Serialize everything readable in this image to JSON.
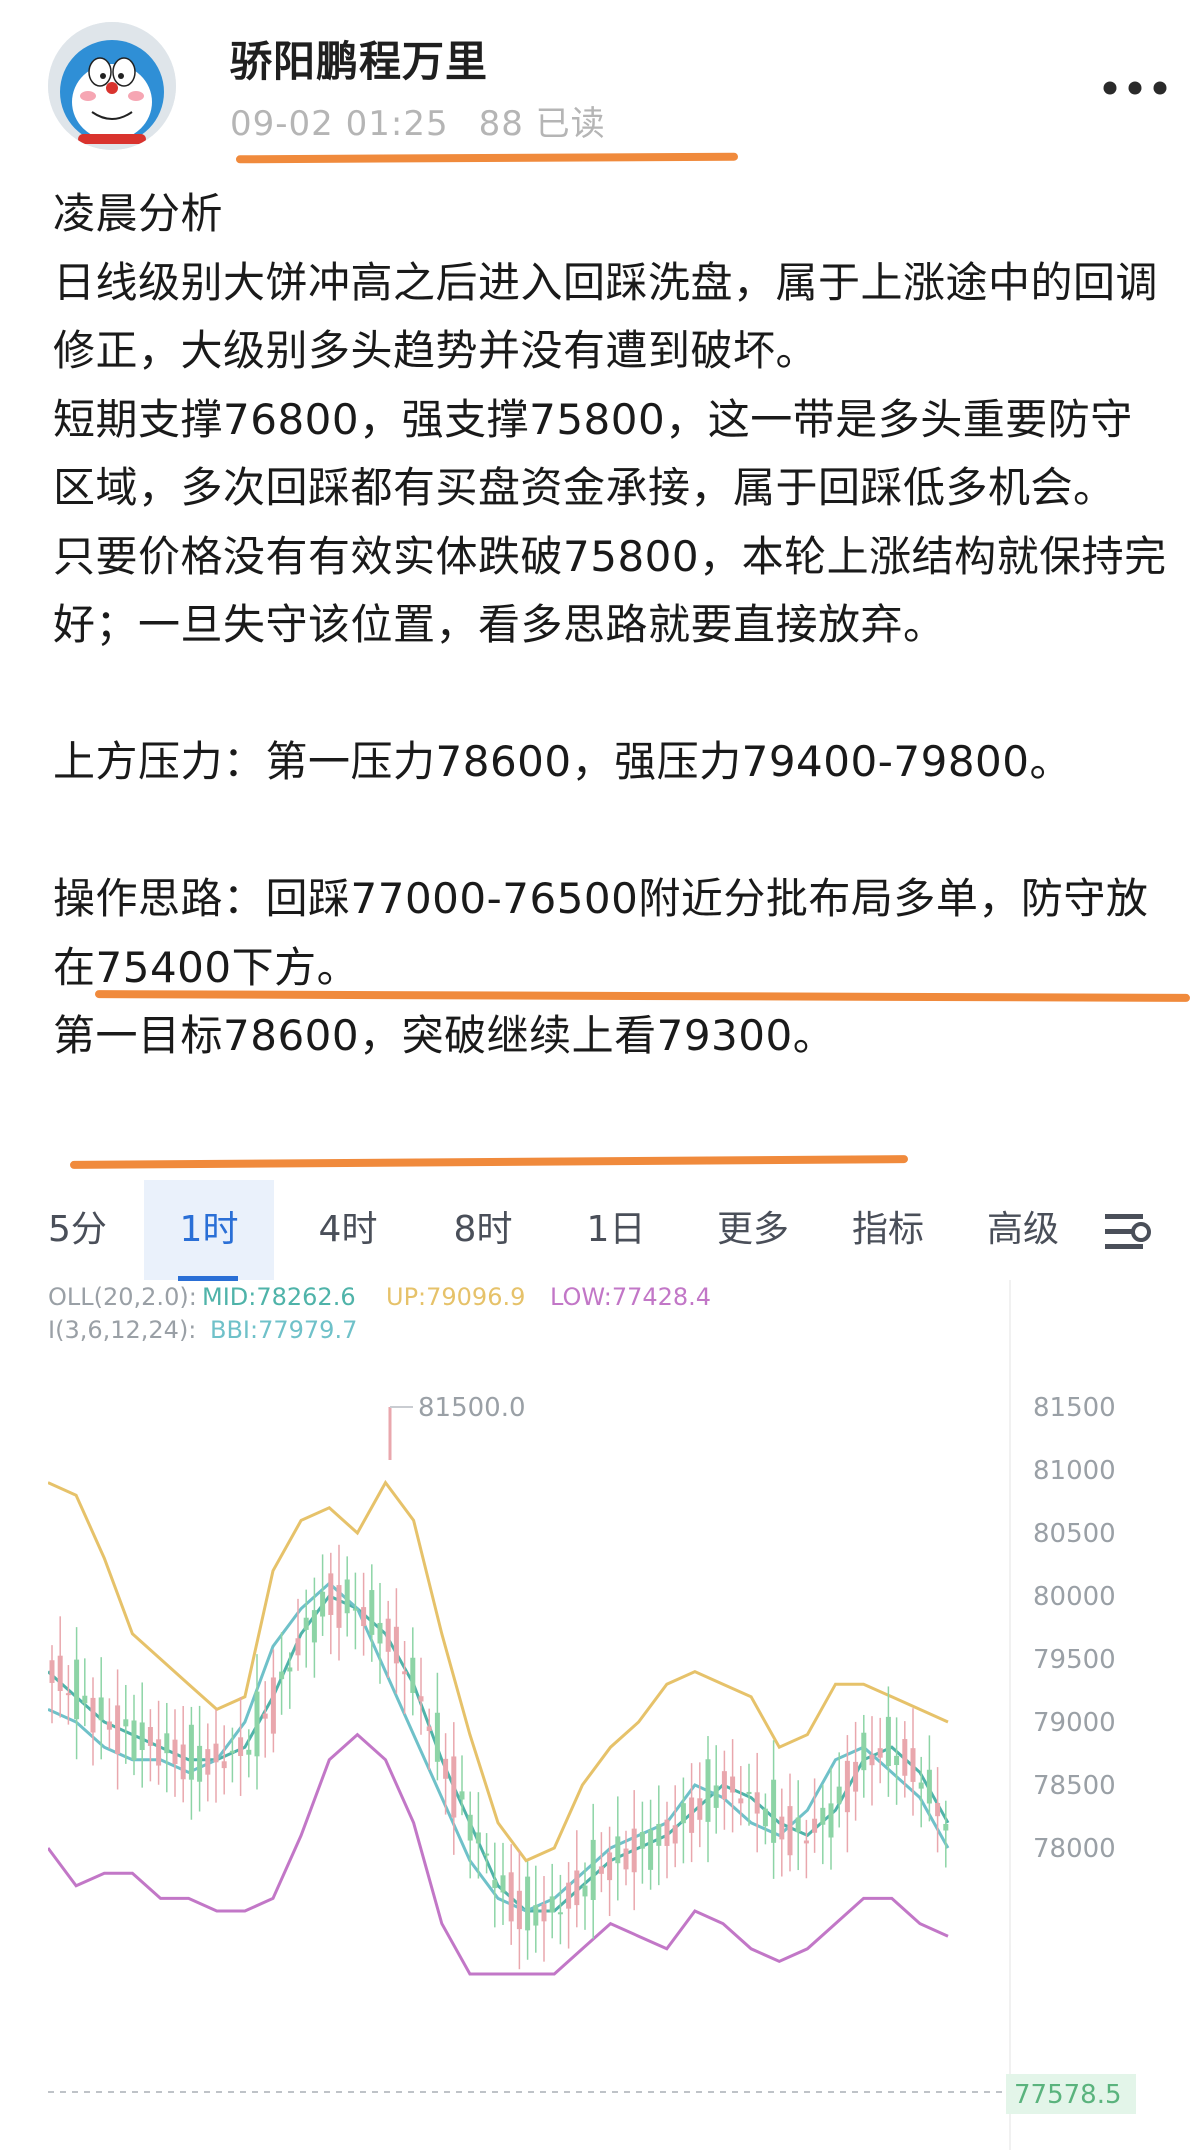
{
  "header": {
    "username": "骄阳鹏程万里",
    "timestamp": "09-02 01:25",
    "reads": "88 已读"
  },
  "post": {
    "paragraphs": [
      "凌晨分析",
      "日线级别大饼冲高之后进入回踩洗盘，属于上涨途中的回调修正，大级别多头趋势并没有遭到破坏。",
      "短期支撑76800，强支撑75800，这一带是多头重要防守区域，多次回踩都有买盘资金承接，属于回踩低多机会。",
      "只要价格没有有效实体跌破75800，本轮上涨结构就保持完好；一旦失守该位置，看多思路就要直接放弃。",
      "",
      "上方压力：第一压力78600，强压力79400-79800。",
      "",
      "操作思路：回踩77000-76500附近分批布局多单，防守放在75400下方。",
      "第一目标78600，突破继续上看79300。"
    ]
  },
  "chart": {
    "tabs": [
      "5分",
      "1时",
      "4时",
      "8时",
      "1日",
      "更多",
      "指标",
      "高级"
    ],
    "active_tab": "1时",
    "indicator_line1": {
      "prefix": "OLL(20,2.0):",
      "mid": "MID:78262.6",
      "up": "UP:79096.9",
      "low": "LOW:77428.4"
    },
    "indicator_line2": {
      "prefix": "I(3,6,12,24):",
      "bbi": "BBI:77979.7"
    },
    "peak_label": "81500.0",
    "current_price": "77578.5",
    "colors": {
      "up": "#8dd4a6",
      "down": "#e9a7ad",
      "mid": "#4fb3a9",
      "upper": "#e6c26a",
      "lower": "#c277c7",
      "bbi": "#6fc1c9",
      "accent": "#2a6fd6",
      "highlight": "#f08a3c"
    }
  },
  "chart_data": {
    "type": "candlestick",
    "ylim": [
      77000,
      81600
    ],
    "yticks": [
      81500,
      81000,
      80500,
      80000,
      79500,
      79000,
      78500,
      78000
    ],
    "series": [
      {
        "name": "MID",
        "values": [
          79400,
          79200,
          79000,
          78900,
          78800,
          78700,
          78700,
          78800,
          79200,
          79700,
          80000,
          79900,
          79700,
          79300,
          78700,
          78200,
          77700,
          77500,
          77500,
          77700,
          77900,
          78000,
          78100,
          78300,
          78500,
          78400,
          78200,
          78100,
          78300,
          78700,
          78800,
          78600,
          78200
        ]
      },
      {
        "name": "UP",
        "values": [
          80900,
          80800,
          80300,
          79700,
          79500,
          79300,
          79100,
          79200,
          80200,
          80600,
          80700,
          80500,
          80900,
          80600,
          79700,
          78900,
          78200,
          77900,
          78000,
          78500,
          78800,
          79000,
          79300,
          79400,
          79300,
          79200,
          78800,
          78900,
          79300,
          79300,
          79200,
          79100,
          79000
        ]
      },
      {
        "name": "LOW",
        "values": [
          78000,
          77700,
          77800,
          77800,
          77600,
          77600,
          77500,
          77500,
          77600,
          78100,
          78700,
          78900,
          78700,
          78200,
          77400,
          76900,
          76700,
          76800,
          77000,
          77200,
          77400,
          77300,
          77200,
          77500,
          77400,
          77200,
          77100,
          77200,
          77400,
          77600,
          77600,
          77400,
          77300
        ]
      },
      {
        "name": "BBI",
        "values": [
          79100,
          79000,
          78800,
          78700,
          78700,
          78600,
          78700,
          79000,
          79600,
          79900,
          80100,
          79900,
          79400,
          78900,
          78400,
          77900,
          77600,
          77500,
          77600,
          77800,
          78000,
          78100,
          78200,
          78500,
          78400,
          78200,
          78100,
          78300,
          78700,
          78800,
          78600,
          78400,
          78000
        ]
      }
    ]
  }
}
